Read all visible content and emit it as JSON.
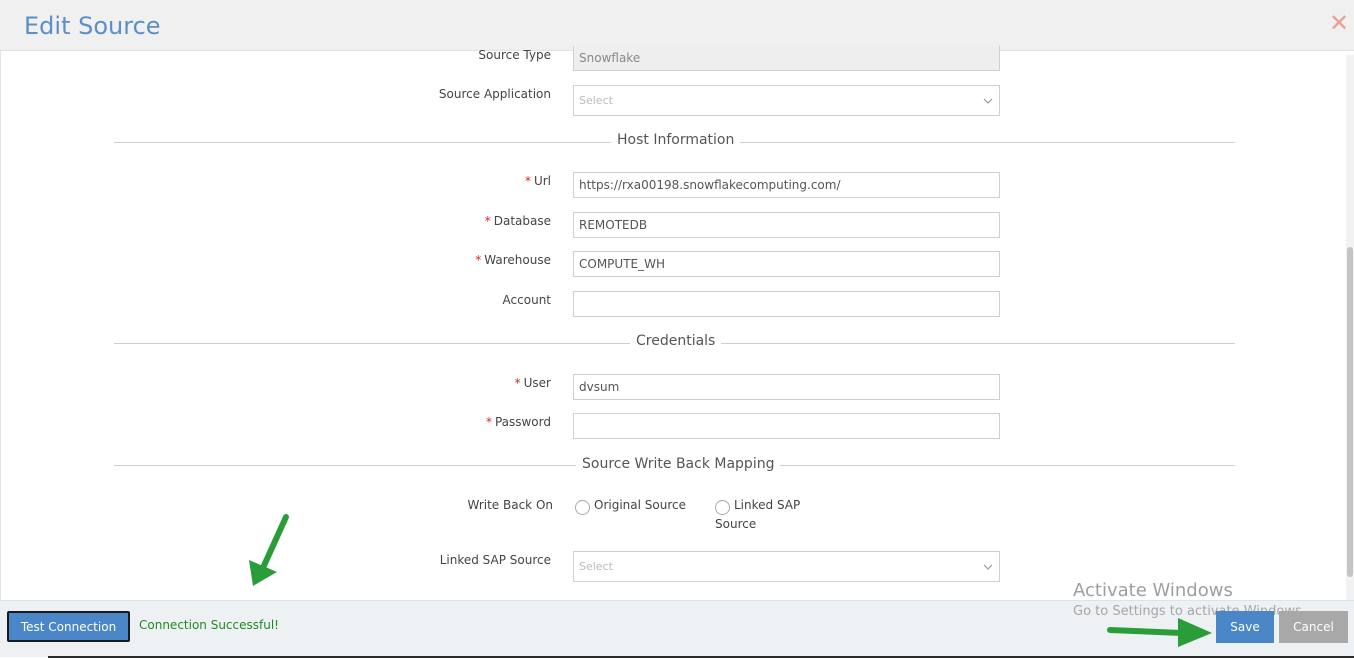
{
  "header": {
    "title": "Edit Source",
    "close_symbol": "✕"
  },
  "form": {
    "source_type": {
      "label": "Source Type",
      "value": "Snowflake"
    },
    "source_application": {
      "label": "Source Application",
      "placeholder": "Select"
    },
    "sections": {
      "host": "Host Information",
      "credentials": "Credentials",
      "write_back": "Source Write Back Mapping"
    },
    "url": {
      "label": "Url",
      "value": "https://rxa00198.snowflakecomputing.com/",
      "required_mark": "*"
    },
    "database": {
      "label": "Database",
      "value": "REMOTEDB",
      "required_mark": "*"
    },
    "warehouse": {
      "label": "Warehouse",
      "value": "COMPUTE_WH",
      "required_mark": "*"
    },
    "account": {
      "label": "Account",
      "value": ""
    },
    "user": {
      "label": "User",
      "value": "dvsum",
      "required_mark": "*"
    },
    "password": {
      "label": "Password",
      "value": "",
      "required_mark": "*"
    },
    "write_back_on": {
      "label": "Write Back On",
      "options": [
        "Original Source",
        "Linked SAP",
        "Source"
      ]
    },
    "linked_sap_source": {
      "label": "Linked SAP Source",
      "placeholder": "Select"
    }
  },
  "footer": {
    "test_connection_label": "Test Connection",
    "status_text": "Connection Successful!",
    "save_label": "Save",
    "cancel_label": "Cancel"
  },
  "watermark": {
    "title": "Activate Windows",
    "subtitle": "Go to Settings to activate Windows."
  },
  "colors": {
    "accent": "#4a86c8",
    "success": "#1f8a1f",
    "required": "#e02020",
    "arrow": "#2a9d3a"
  },
  "icons": [
    "close-icon",
    "chevron-down-icon",
    "arrow-pointer-icon"
  ]
}
